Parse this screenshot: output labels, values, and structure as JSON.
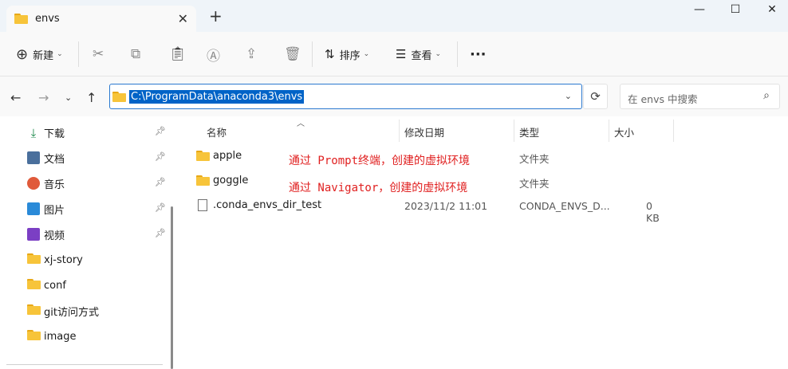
{
  "window": {
    "tab_title": "envs",
    "tab_close": "✕",
    "new_tab": "+",
    "minimize": "—",
    "maximize": "☐",
    "close": "✕"
  },
  "toolbar": {
    "new_label": "新建",
    "sort_label": "排序",
    "view_label": "查看",
    "more": "···"
  },
  "address": {
    "path": "C:\\ProgramData\\anaconda3\\envs",
    "search_placeholder": "在 envs 中搜索"
  },
  "sidebar": {
    "items": [
      {
        "label": "下载",
        "icon": "download-icon",
        "pinned": true
      },
      {
        "label": "文档",
        "icon": "document-icon",
        "pinned": true
      },
      {
        "label": "音乐",
        "icon": "music-icon",
        "pinned": true
      },
      {
        "label": "图片",
        "icon": "picture-icon",
        "pinned": true
      },
      {
        "label": "视频",
        "icon": "video-icon",
        "pinned": true
      },
      {
        "label": "xj-story",
        "icon": "folder-icon",
        "pinned": false
      },
      {
        "label": "conf",
        "icon": "folder-icon",
        "pinned": false
      },
      {
        "label": "git访问方式",
        "icon": "folder-icon",
        "pinned": false
      },
      {
        "label": "image",
        "icon": "folder-icon",
        "pinned": false
      }
    ]
  },
  "columns": {
    "name": "名称",
    "modified": "修改日期",
    "type": "类型",
    "size": "大小"
  },
  "files": [
    {
      "name": "apple",
      "date": "",
      "type": "文件夹",
      "size": "",
      "kind": "folder"
    },
    {
      "name": "goggle",
      "date": "",
      "type": "文件夹",
      "size": "",
      "kind": "folder"
    },
    {
      "name": ".conda_envs_dir_test",
      "date": "2023/11/2 11:01",
      "type": "CONDA_ENVS_D...",
      "size": "0 KB",
      "kind": "file"
    }
  ],
  "annotations": [
    "通过 Prompt终端，创建的虚拟环境",
    "通过 Navigator，创建的虚拟环境"
  ],
  "colors": {
    "accent": "#0063c7",
    "annotation": "#e02020",
    "folder": "#f7c43a"
  }
}
